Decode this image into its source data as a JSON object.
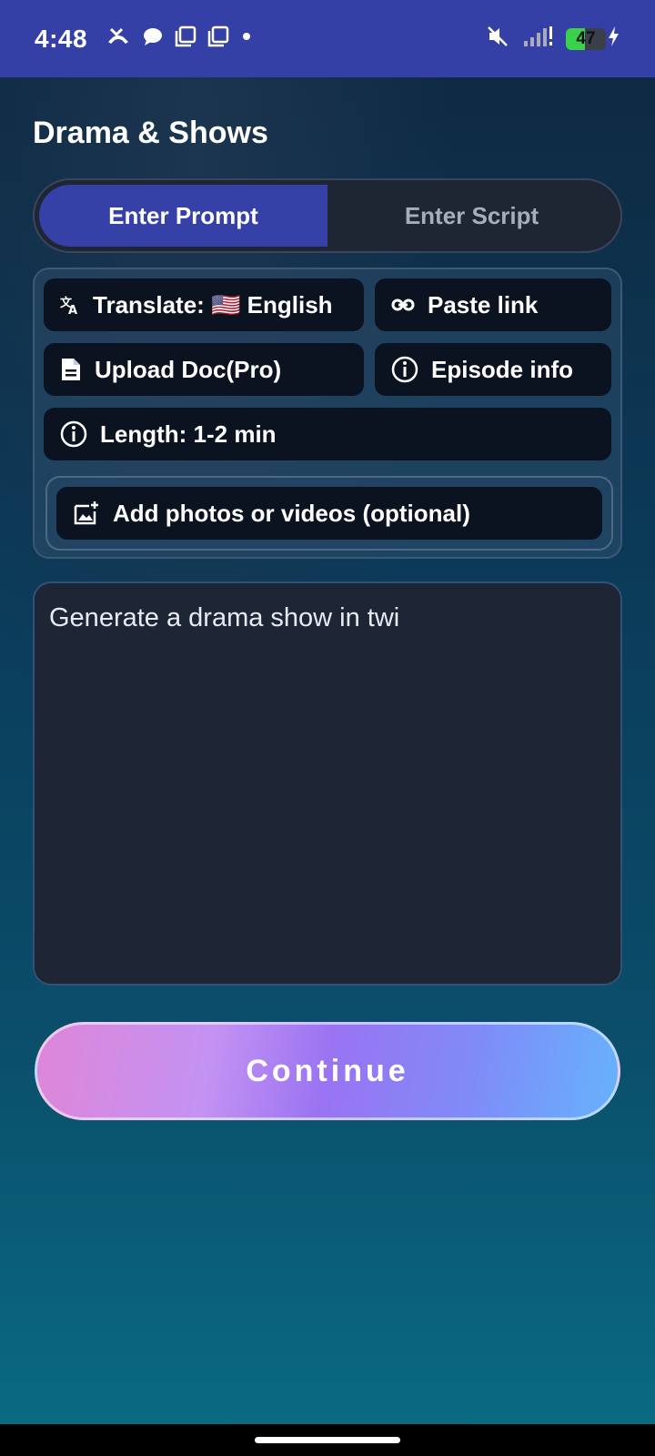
{
  "status_bar": {
    "time": "4:48",
    "battery_level": "47",
    "battery_fraction": 0.47,
    "icons": [
      "missed-call-icon",
      "chat-bubble-icon",
      "copy-icon",
      "copy-icon",
      "dot-icon",
      "mute-icon",
      "signal-icon",
      "battery-icon",
      "charging-icon"
    ]
  },
  "page": {
    "title": "Drama & Shows"
  },
  "tabs": [
    {
      "label": "Enter Prompt",
      "active": true
    },
    {
      "label": "Enter Script",
      "active": false
    }
  ],
  "options": {
    "translate_label": "Translate: 🇺🇸 English",
    "paste_link_label": "Paste link",
    "upload_doc_label": "Upload Doc(Pro)",
    "episode_info_label": "Episode info",
    "length_label": "Length: 1-2 min",
    "add_media_label": "Add photos or videos (optional)"
  },
  "prompt": {
    "value": "Generate a drama show in twi"
  },
  "actions": {
    "continue_label": "Continue"
  },
  "colors": {
    "status_bar": "#3440a6",
    "active_tab": "#3641a8",
    "chip_bg": "#0b1320",
    "battery_green": "#3ad24a"
  }
}
